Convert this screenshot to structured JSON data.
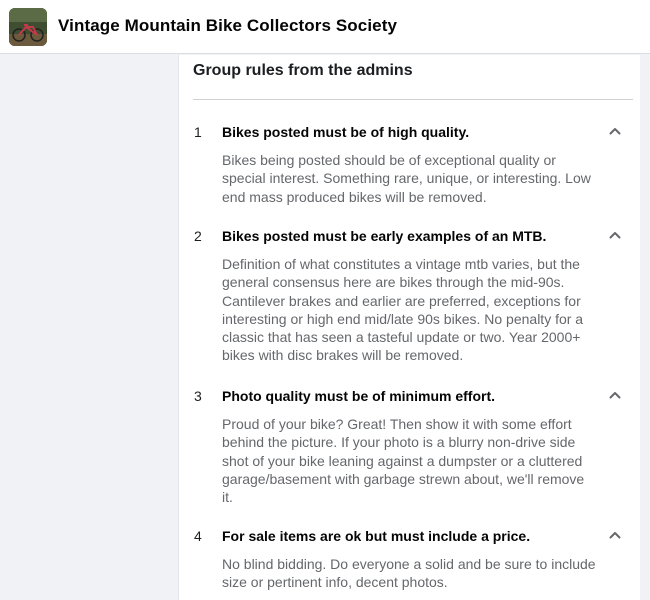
{
  "header": {
    "group_name": "Vintage Mountain Bike Collectors Society"
  },
  "rules_section": {
    "title": "Group rules from the admins",
    "rules": [
      {
        "number": "1",
        "title": "Bikes posted must be of high quality.",
        "description": "Bikes being posted should be of exceptional quality or special interest. Something rare, unique, or interesting. Low end mass produced bikes will be removed.",
        "expanded": true
      },
      {
        "number": "2",
        "title": "Bikes posted must be early examples of an MTB.",
        "description": "Definition of what constitutes a vintage mtb varies, but the general consensus here are bikes through the mid-90s. Cantilever brakes and earlier are preferred, exceptions for interesting or high end mid/late 90s bikes. No penalty for a classic that has seen a tasteful update or two. Year 2000+ bikes with disc brakes will be removed.",
        "expanded": true
      },
      {
        "number": "3",
        "title": "Photo quality must be of minimum effort.",
        "description": "Proud of your bike? Great! Then show it with some effort behind the picture. If your photo is a blurry non-drive side shot of your bike leaning against a dumpster or a cluttered garage/basement with garbage strewn about, we'll remove it.",
        "expanded": true
      },
      {
        "number": "4",
        "title": "For sale items are ok but must include a price.",
        "description": "No blind bidding. Do everyone a solid and be sure to include size or pertinent info, decent photos.",
        "expanded": true
      }
    ]
  },
  "colors": {
    "background": "#f0f2f5",
    "card": "#ffffff",
    "primary_text": "#050505",
    "secondary_text": "#65676b"
  },
  "icons": {
    "collapse": "chevron-up-icon"
  }
}
